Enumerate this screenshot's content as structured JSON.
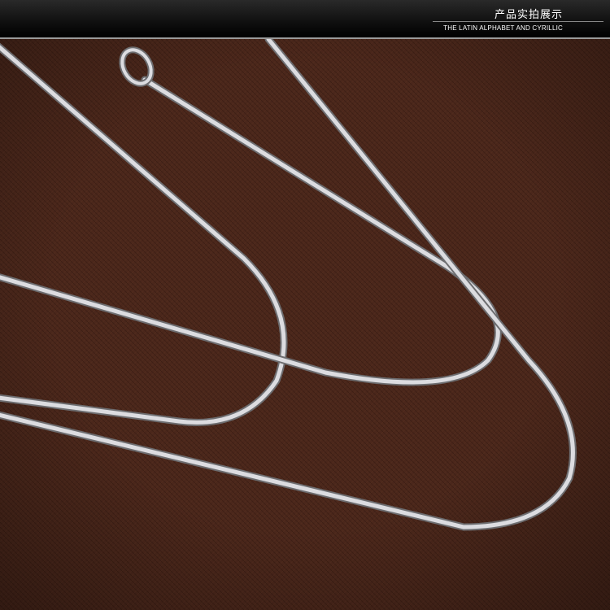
{
  "header": {
    "title_zh": "产品实拍展示",
    "title_en": "THE LATIN ALPHABET AND CYRILLIC"
  },
  "photo": {
    "subject": "silver-wire-necklace-chains",
    "background_color": "#4a261a",
    "wire_color": "#d8d8dc"
  }
}
